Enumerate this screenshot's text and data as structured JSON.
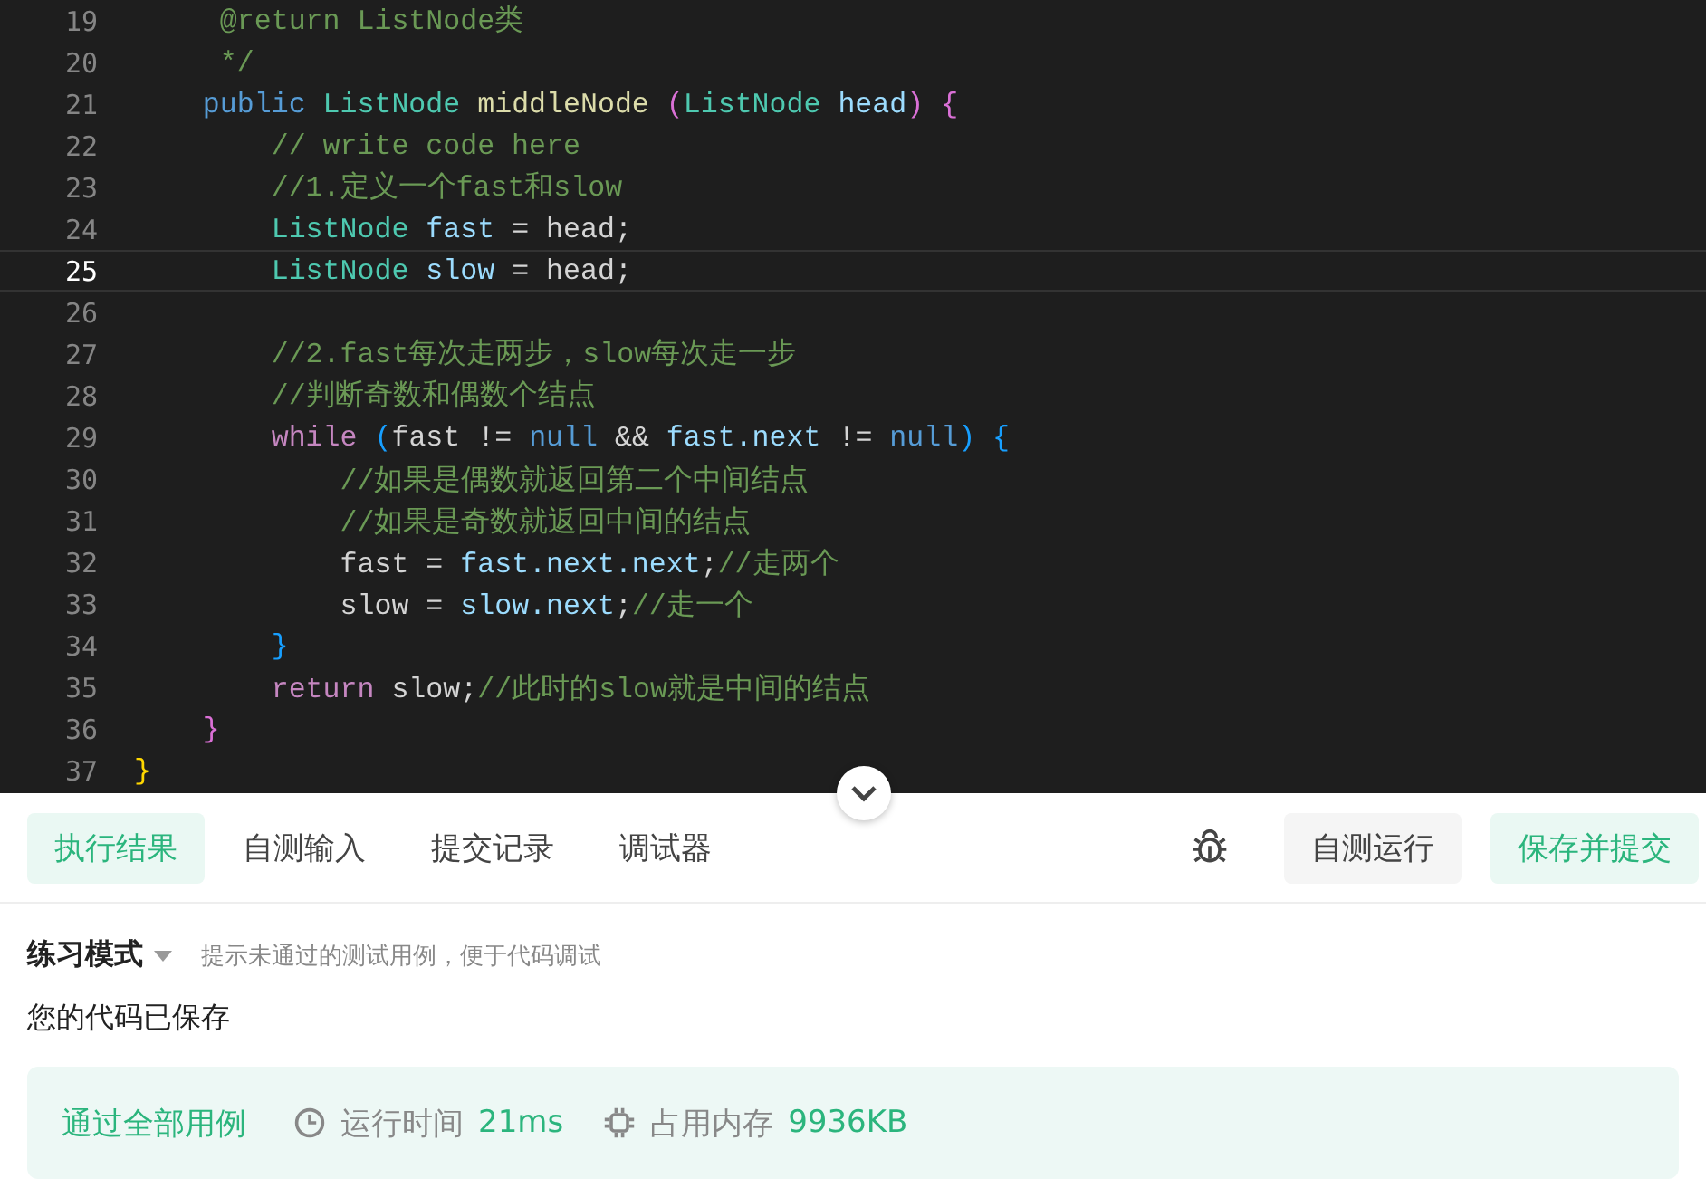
{
  "editor": {
    "lines": [
      {
        "number": "19",
        "current": false,
        "tokens": [
          {
            "kind": "comment",
            "text": "     @return ListNode类"
          }
        ]
      },
      {
        "number": "20",
        "current": false,
        "tokens": [
          {
            "kind": "comment",
            "text": "     */"
          }
        ]
      },
      {
        "number": "21",
        "current": false,
        "tokens": [
          {
            "kind": "keyword",
            "text": "    public"
          },
          {
            "kind": "type",
            "text": " ListNode"
          },
          {
            "kind": "function",
            "text": " middleNode"
          },
          {
            "kind": "paren",
            "text": " ("
          },
          {
            "kind": "type",
            "text": "ListNode"
          },
          {
            "kind": "variable",
            "text": " head"
          },
          {
            "kind": "paren",
            "text": ") {"
          }
        ]
      },
      {
        "number": "22",
        "current": false,
        "tokens": [
          {
            "kind": "comment",
            "text": "        // write code here"
          }
        ]
      },
      {
        "number": "23",
        "current": false,
        "tokens": [
          {
            "kind": "comment",
            "text": "        //1.定义一个fast和slow"
          }
        ]
      },
      {
        "number": "24",
        "current": false,
        "tokens": [
          {
            "kind": "type",
            "text": "        ListNode"
          },
          {
            "kind": "variable",
            "text": " fast"
          },
          {
            "kind": "plain",
            "text": " = head;"
          }
        ]
      },
      {
        "number": "25",
        "current": true,
        "tokens": [
          {
            "kind": "type",
            "text": "        ListNode"
          },
          {
            "kind": "variable",
            "text": " slow"
          },
          {
            "kind": "plain",
            "text": " = head;"
          }
        ]
      },
      {
        "number": "26",
        "current": false
      },
      {
        "number": "27",
        "current": false,
        "tokens": [
          {
            "kind": "comment",
            "text": "        //2.fast每次走两步，slow每次走一步"
          }
        ]
      },
      {
        "number": "28",
        "current": false,
        "tokens": [
          {
            "kind": "comment",
            "text": "        //判断奇数和偶数个结点"
          }
        ]
      },
      {
        "number": "29",
        "current": false,
        "tokens": [
          {
            "kind": "control",
            "text": "        while"
          },
          {
            "kind": "bracket",
            "text": " ("
          },
          {
            "kind": "plain",
            "text": "fast != "
          },
          {
            "kind": "keyword",
            "text": "null"
          },
          {
            "kind": "plain",
            "text": " && "
          },
          {
            "kind": "variable",
            "text": "fast.next"
          },
          {
            "kind": "plain",
            "text": " != "
          },
          {
            "kind": "keyword",
            "text": "null"
          },
          {
            "kind": "bracket",
            "text": ") {"
          }
        ]
      },
      {
        "number": "30",
        "current": false,
        "tokens": [
          {
            "kind": "comment",
            "text": "            //如果是偶数就返回第二个中间结点"
          }
        ]
      },
      {
        "number": "31",
        "current": false,
        "tokens": [
          {
            "kind": "comment",
            "text": "            //如果是奇数就返回中间的结点"
          }
        ]
      },
      {
        "number": "32",
        "current": false,
        "tokens": [
          {
            "kind": "plain",
            "text": "            fast = "
          },
          {
            "kind": "variable",
            "text": "fast.next.next"
          },
          {
            "kind": "plain",
            "text": ";"
          },
          {
            "kind": "comment",
            "text": "//走两个"
          }
        ]
      },
      {
        "number": "33",
        "current": false,
        "tokens": [
          {
            "kind": "plain",
            "text": "            slow = "
          },
          {
            "kind": "variable",
            "text": "slow.next"
          },
          {
            "kind": "plain",
            "text": ";"
          },
          {
            "kind": "comment",
            "text": "//走一个"
          }
        ]
      },
      {
        "number": "34",
        "current": false,
        "tokens": [
          {
            "kind": "bracket",
            "text": "        }"
          }
        ]
      },
      {
        "number": "35",
        "current": false,
        "tokens": [
          {
            "kind": "control",
            "text": "        return"
          },
          {
            "kind": "plain",
            "text": " slow;"
          },
          {
            "kind": "comment",
            "text": "//此时的slow就是中间的结点"
          }
        ]
      },
      {
        "number": "36",
        "current": false,
        "tokens": [
          {
            "kind": "paren",
            "text": "    }"
          }
        ]
      },
      {
        "number": "37",
        "current": false,
        "tokens": [
          {
            "kind": "brace",
            "text": "}"
          }
        ]
      }
    ]
  },
  "tabs": [
    {
      "label": "执行结果",
      "selected": true
    },
    {
      "label": "自测输入",
      "selected": false
    },
    {
      "label": "提交记录",
      "selected": false
    },
    {
      "label": "调试器",
      "selected": false
    }
  ],
  "actions": [
    {
      "label": "自测运行",
      "kind": "secondary"
    },
    {
      "label": "保存并提交",
      "kind": "primary"
    }
  ],
  "mode": {
    "label": "练习模式",
    "hint": "提示未通过的测试用例，便于代码调试"
  },
  "status": "您的代码已保存",
  "result": {
    "verdict": "通过全部用例",
    "time_label": "运行时间",
    "time": "21ms",
    "memory_label": "占用内存",
    "memory": "9936KB"
  }
}
